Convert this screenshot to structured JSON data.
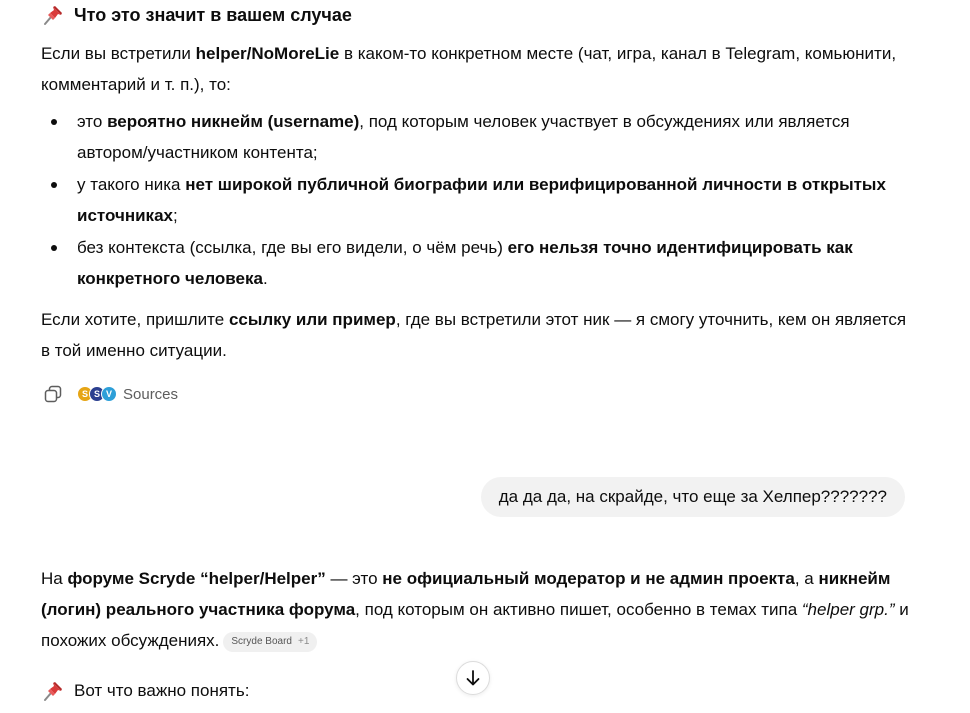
{
  "section1": {
    "heading": "Что это значит в вашем случае",
    "intro": {
      "t1": "Если вы встретили ",
      "b1": "helper/NoMoreLie",
      "t2": " в каком-то конкретном месте (чат, игра, канал в Telegram, комьюнити, комментарий и т. п.), то:"
    },
    "bullets": [
      {
        "t1": "это ",
        "b1": "вероятно никнейм (username)",
        "t2": ", под которым человек участвует в обсуждениях или является автором/участником контента;"
      },
      {
        "t1": "у такого ника ",
        "b1": "нет широкой публичной биографии или верифицированной личности в открытых источниках",
        "t2": ";"
      },
      {
        "t1": "без контекста (ссылка, где вы его видели, о чём речь) ",
        "b1": "его нельзя точно идентифицировать как конкретного человека",
        "t2": "."
      }
    ],
    "outro": {
      "t1": "Если хотите, пришлите ",
      "b1": "ссылку или пример",
      "t2": ", где вы встретили этот ник — я смогу уточнить, кем он является в той именно ситуации."
    }
  },
  "actions": {
    "sources_label": "Sources",
    "source_icons": [
      "source-icon-1",
      "source-icon-2",
      "source-icon-3"
    ]
  },
  "user_message": "да да да, на скрайде, что еще за Хелпер???????",
  "answer": {
    "t1": "На ",
    "b1": "форуме Scryde “helper/Helper”",
    "t2": " — это ",
    "b2": "не официальный модератор и не админ проекта",
    "t3": ", а ",
    "b3": "никнейм (логин) реального участника форума",
    "t4": ", под которым он активно пишет, особенно в темах типа ",
    "i1": "“helper grp.”",
    "t5": " и похожих обсуждениях.",
    "chip_label": "Scryde Board",
    "chip_more": "+1"
  },
  "section2": {
    "heading": "Вот что важно понять:"
  },
  "colors": {
    "pin_red": "#d93a3a",
    "bubble_bg": "#f2f2f2"
  }
}
